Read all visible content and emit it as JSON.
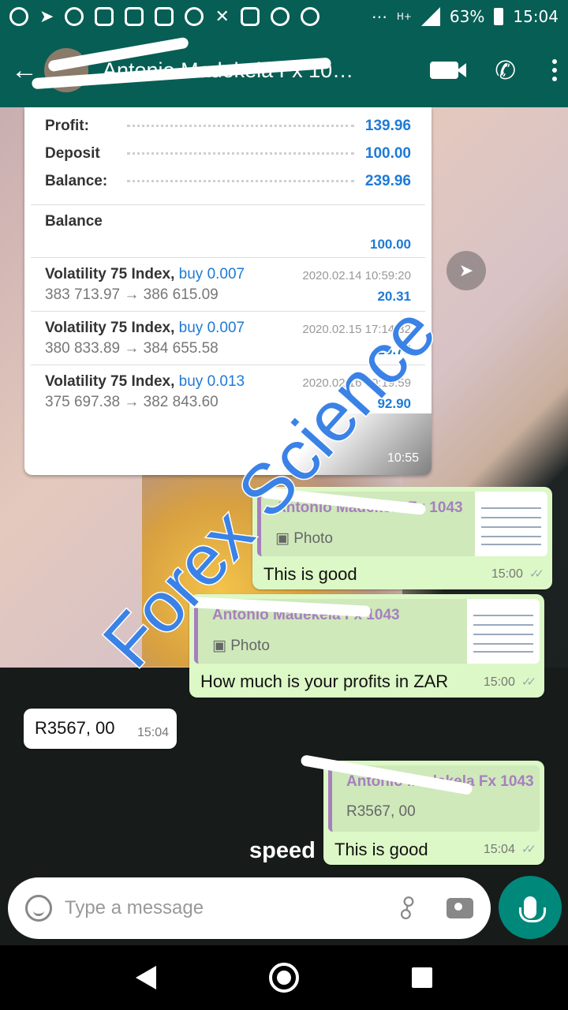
{
  "status_bar": {
    "battery": "63%",
    "time": "15:04",
    "network": "H+",
    "overflow": "⋯"
  },
  "app_bar": {
    "chat_title": "Antonio Madekela Fx 10…",
    "icons": [
      "back-arrow-icon",
      "video-call-icon",
      "phone-icon",
      "more-options-icon"
    ]
  },
  "statement": {
    "rows": [
      {
        "label": "Profit:",
        "value": "139.96"
      },
      {
        "label": "Deposit",
        "value": "100.00"
      },
      {
        "label": "Balance:",
        "value": "239.96"
      }
    ],
    "balance_entry": {
      "label": "Balance",
      "value": "100.00"
    },
    "trades": [
      {
        "symbol": "Volatility 75 Index,",
        "side": "buy 0.007",
        "prices": "383 713.97 → 386 615.09",
        "datetime": "2020.02.14 10:59:20",
        "profit": "20.31"
      },
      {
        "symbol": "Volatility 75 Index,",
        "side": "buy 0.007",
        "prices": "380 833.89 → 384 655.58",
        "datetime": "2020.02.15 17:14:32",
        "profit": "26.75"
      },
      {
        "symbol": "Volatility 75 Index,",
        "side": "buy 0.013",
        "prices": "375 697.38 → 382 843.60",
        "datetime": "2020.02.16 00:19:59",
        "profit": "92.90"
      }
    ],
    "time": "10:55"
  },
  "messages": [
    {
      "quoted_name": "Antonio Madekela Fx 1043",
      "quoted_sub": "Photo",
      "text": "This is good",
      "time": "15:00"
    },
    {
      "quoted_name": "Antonio Madekela Fx 1043",
      "quoted_sub": "Photo",
      "text": "How much is your profits in ZAR",
      "time": "15:00"
    },
    {
      "text": "R3567, 00",
      "time": "15:04"
    },
    {
      "quoted_name": "Antonio Madekela Fx 1043",
      "quoted_sub": "R3567, 00",
      "text": "This is good",
      "time": "15:04"
    }
  ],
  "watermark": "Forex Science",
  "overlay_text": "speed",
  "composer": {
    "placeholder": "Type a message"
  },
  "colors": {
    "header": "#075e54",
    "outgoing_bubble": "#dcf8c6",
    "quote_accent": "#a77fbf",
    "mic_button": "#00897b"
  }
}
